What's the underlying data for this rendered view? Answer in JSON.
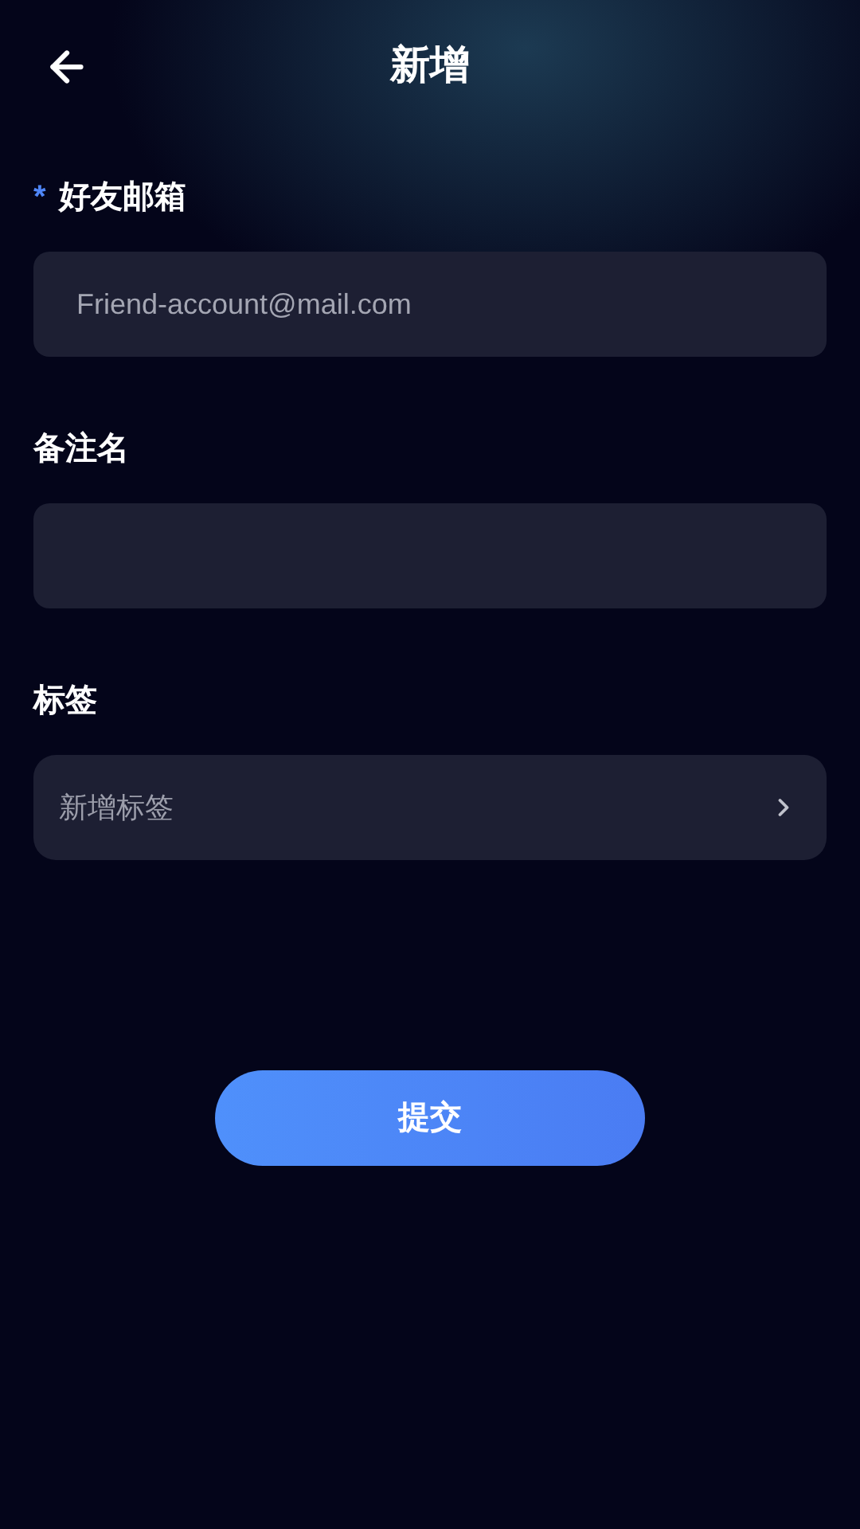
{
  "header": {
    "title": "新增"
  },
  "form": {
    "fields": [
      {
        "kind": "input",
        "label": "好友邮箱",
        "required_mark": "*",
        "placeholder": "Friend-account@mail.com"
      },
      {
        "kind": "input",
        "label": "备注名"
      },
      {
        "kind": "select",
        "label": "标签",
        "placeholder": "新增标签"
      }
    ]
  },
  "submit": {
    "label": "提交"
  }
}
